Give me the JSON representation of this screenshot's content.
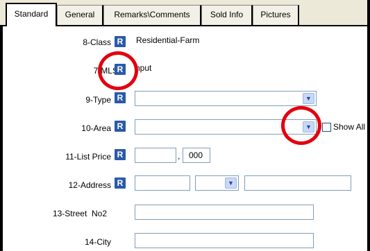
{
  "tabs": [
    {
      "label": "Standard"
    },
    {
      "label": "General"
    },
    {
      "label": "Remarks\\Comments"
    },
    {
      "label": "Sold Info"
    },
    {
      "label": "Pictures"
    }
  ],
  "required_icon": "R",
  "fields": {
    "class": {
      "label": "8-Class",
      "value": "Residential-Farm"
    },
    "mls": {
      "label": "7-MLS #",
      "value": "nput"
    },
    "type": {
      "label": "9-Type",
      "value": ""
    },
    "area": {
      "label": "10-Area",
      "value": "",
      "show_all_label": "Show All",
      "show_all_checked": false
    },
    "list_price": {
      "label": "11-List Price",
      "value": "",
      "suffix": "000",
      "separator": ","
    },
    "address": {
      "label": "12-Address",
      "value1": "",
      "value2": "",
      "value3": ""
    },
    "street_no2": {
      "label": "13-Street  No2",
      "value": ""
    },
    "city": {
      "label": "14-City",
      "value": ""
    }
  },
  "colors": {
    "accent": "#2a5aa8",
    "highlight_circle": "#e3000f"
  }
}
